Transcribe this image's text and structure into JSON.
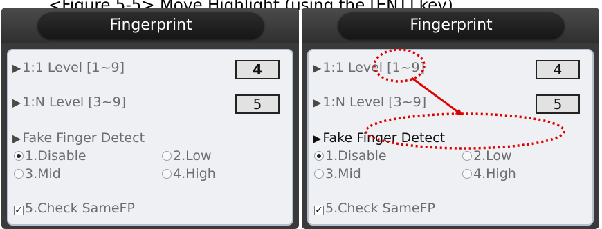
{
  "caption": "<Figure 5-5> Move Highlight (using the [ENT] key)",
  "panels": [
    {
      "title": "Fingerprint",
      "level_11_label": "1:1 Level [1~9]",
      "level_11_value": "4",
      "level_1n_label": "1:N Level [3~9]",
      "level_1n_value": "5",
      "fake_label": "Fake Finger Detect",
      "options": [
        "1.Disable",
        "2.Low",
        "3.Mid",
        "4.High"
      ],
      "selected_option": "1.Disable",
      "check_label": "5.Check SameFP",
      "check_checked": true,
      "highlighted_item": "1:1 Level value"
    },
    {
      "title": "Fingerprint",
      "level_11_label": "1:1 Level [1~9]",
      "level_11_value": "4",
      "level_1n_label": "1:N Level [3~9]",
      "level_1n_value": "5",
      "fake_label": "Fake Finger Detect",
      "options": [
        "1.Disable",
        "2.Low",
        "3.Mid",
        "4.High"
      ],
      "selected_option": "1.Disable",
      "check_label": "5.Check SameFP",
      "check_checked": true,
      "highlighted_item": "Fake Finger Detect"
    }
  ],
  "icons": {
    "item_marker": "triangle-right-icon",
    "annotation_arrow": "arrow-icon",
    "annotation_ellipse": "dotted-ellipse"
  },
  "colors": {
    "annotation": "#e00000",
    "title_bg": "#1e1e1e",
    "panel_bg": "#eef0f4"
  }
}
